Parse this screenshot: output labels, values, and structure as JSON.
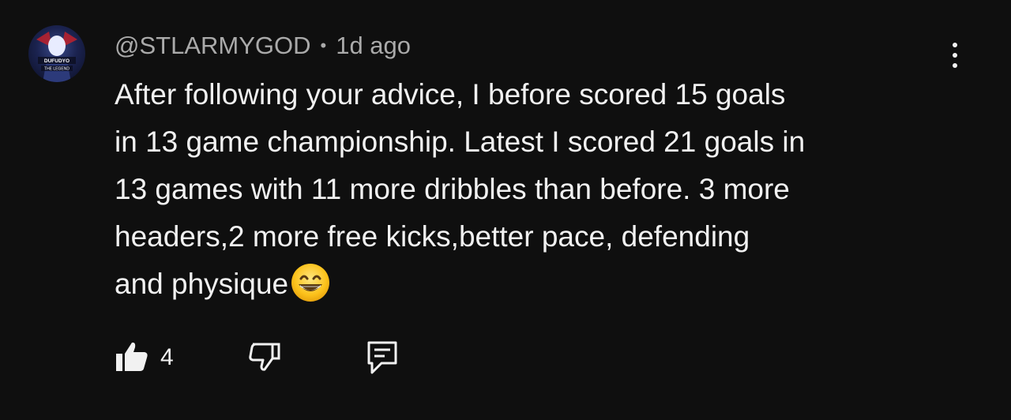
{
  "comment": {
    "author": "@STLARMYGOD",
    "separator": "•",
    "time": "1d ago",
    "text_lines": [
      "After following your advice, I before scored 15 goals",
      "in 13 game championship. Latest I scored 21 goals in",
      "13 games with 11 more dribbles than before. 3 more",
      "headers,2 more free kicks,better pace, defending",
      "and physique"
    ],
    "emoji": "grinning-face-with-smiling-eyes",
    "avatar_text": [
      "DUFUDYO",
      "THE LEGEND"
    ],
    "like_count": "4"
  },
  "icons": {
    "like": "thumbs-up-icon",
    "dislike": "thumbs-down-icon",
    "reply": "reply-comment-icon",
    "menu": "more-vertical-icon"
  },
  "colors": {
    "background": "#0f0f0f",
    "text": "#f1f1f1",
    "secondary_text": "#aaaaaa"
  }
}
